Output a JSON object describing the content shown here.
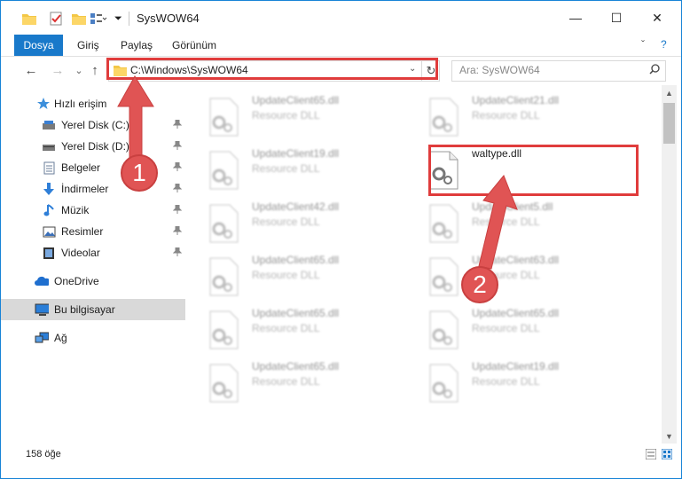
{
  "window": {
    "title": "SysWOW64",
    "minimize": "—",
    "maximize": "☐",
    "close": "✕"
  },
  "ribbon": {
    "tabs": [
      "Dosya",
      "Giriş",
      "Paylaş",
      "Görünüm"
    ],
    "collapse": "ˇ",
    "help": "?"
  },
  "address": {
    "path": "C:\\Windows\\SysWOW64",
    "back": "←",
    "forward": "→",
    "recent": "⌄",
    "up": "↑",
    "dropdown": "⌄",
    "refresh": "↻"
  },
  "search": {
    "placeholder": "Ara: SysWOW64",
    "icon": "search-icon"
  },
  "sidebar": {
    "items": [
      {
        "label": "Hızlı erişim",
        "icon": "star-icon",
        "pinned": false
      },
      {
        "label": "Yerel Disk (C:)",
        "icon": "drive-icon",
        "pinned": true
      },
      {
        "label": "Yerel Disk (D:)",
        "icon": "drive-icon",
        "pinned": true
      },
      {
        "label": "Belgeler",
        "icon": "documents-icon",
        "pinned": true
      },
      {
        "label": "İndirmeler",
        "icon": "download-icon",
        "pinned": true
      },
      {
        "label": "Müzik",
        "icon": "music-icon",
        "pinned": true
      },
      {
        "label": "Resimler",
        "icon": "pictures-icon",
        "pinned": true
      },
      {
        "label": "Videolar",
        "icon": "video-icon",
        "pinned": true
      },
      {
        "label": "OneDrive",
        "icon": "cloud-icon",
        "pinned": false
      },
      {
        "label": "Bu bilgisayar",
        "icon": "computer-icon",
        "pinned": false,
        "selected": true
      },
      {
        "label": "Ağ",
        "icon": "network-icon",
        "pinned": false
      }
    ],
    "pin_glyph": "📌"
  },
  "files": [
    {
      "name": "UpdateClient65.dll",
      "type": "Resource DLL"
    },
    {
      "name": "UpdateClient21.dll",
      "type": "Resource DLL"
    },
    {
      "name": "UpdateClient19.dll",
      "type": "Resource DLL"
    },
    {
      "name": "waltype.dll",
      "type": ""
    },
    {
      "name": "UpdateClient42.dll",
      "type": "Resource DLL"
    },
    {
      "name": "UpdateClient5.dll",
      "type": "Resource DLL"
    },
    {
      "name": "UpdateClient65.dll",
      "type": "Resource DLL"
    },
    {
      "name": "UpdateClient63.dll",
      "type": "Resource DLL"
    },
    {
      "name": "UpdateClient65.dll",
      "type": "Resource DLL"
    },
    {
      "name": "UpdateClient65.dll",
      "type": "Resource DLL"
    },
    {
      "name": "UpdateClient65.dll",
      "type": "Resource DLL"
    },
    {
      "name": "UpdateClient19.dll",
      "type": "Resource DLL"
    }
  ],
  "status": {
    "count": "158 öğe"
  },
  "annotations": {
    "step1": "1",
    "step2": "2",
    "color": "#e05454"
  }
}
